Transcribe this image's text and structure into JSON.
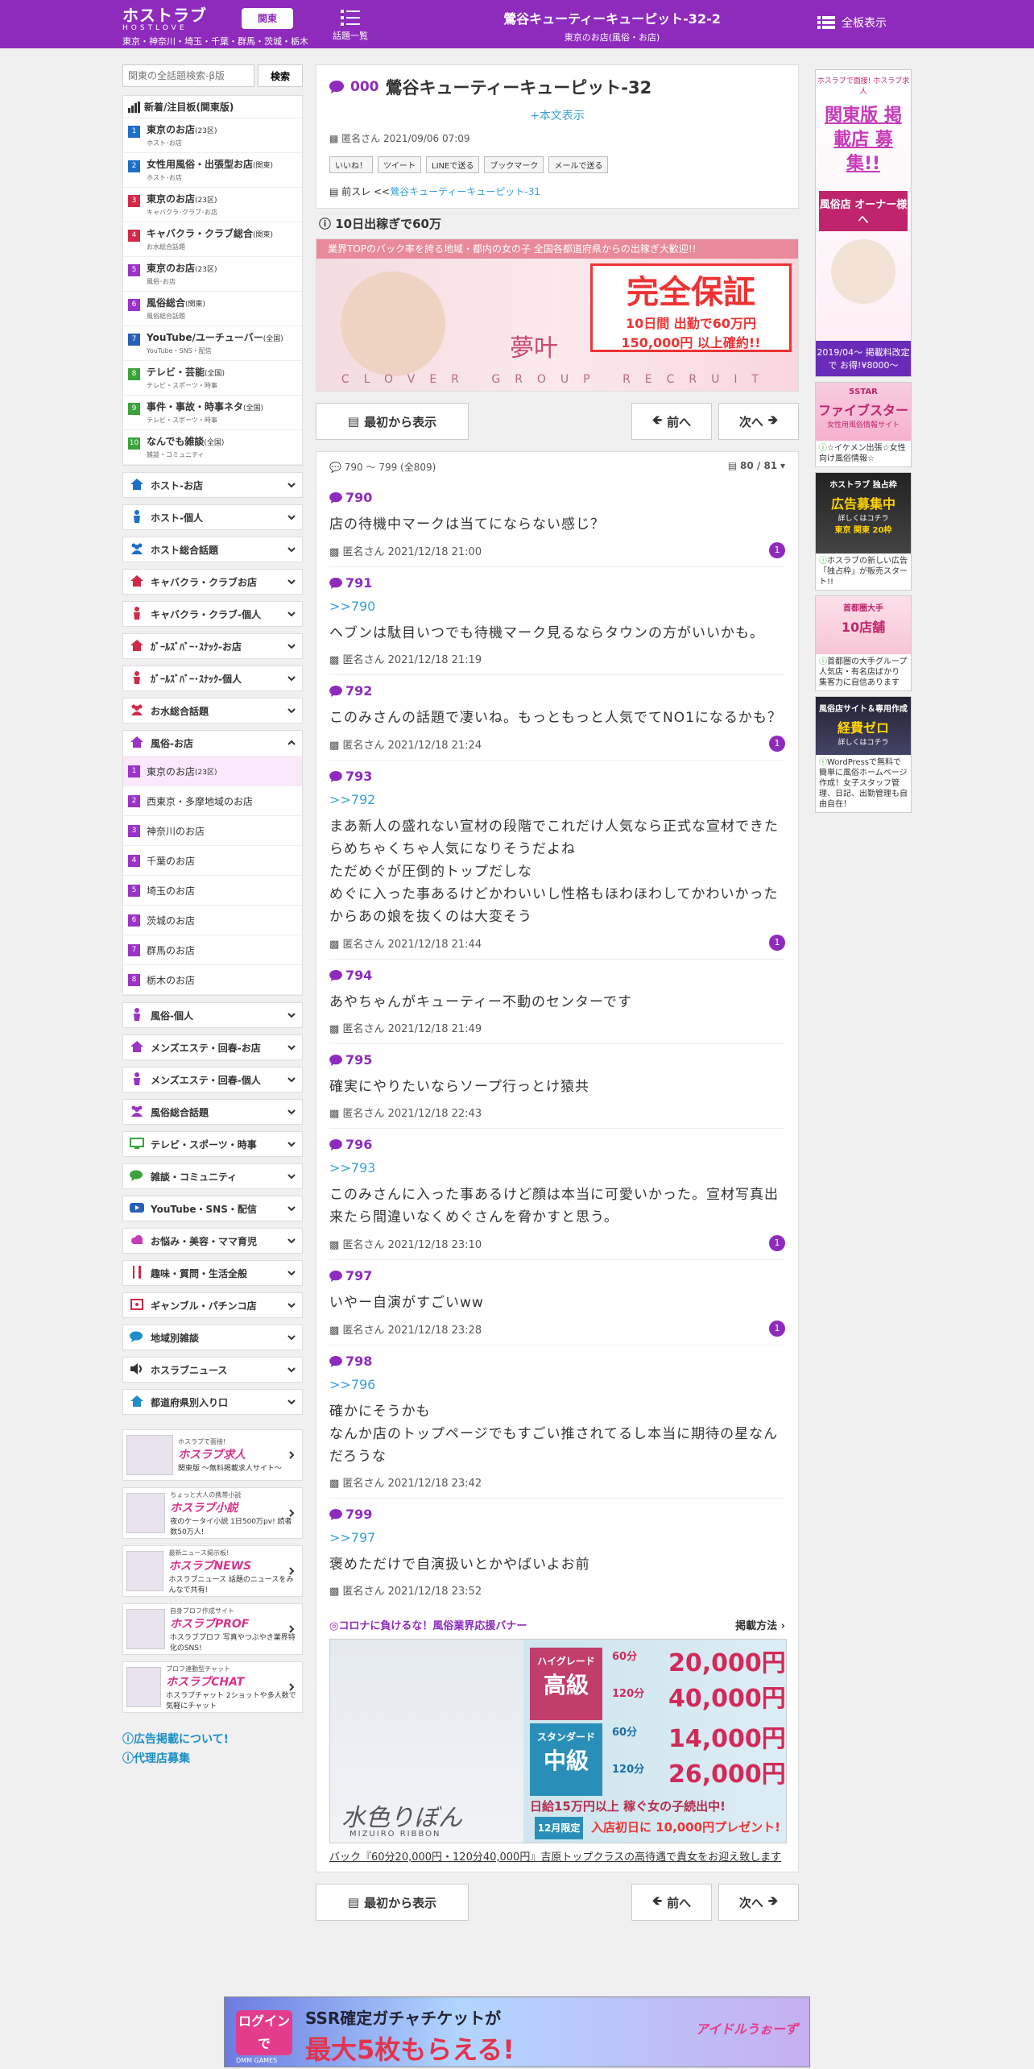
{
  "header": {
    "logo_main": "ホストラブ",
    "logo_sub": "HOSTLOVE",
    "region_button": "関東",
    "prefectures": "東京・神奈川・埼玉・千葉・群馬・茨城・栃木",
    "topics_label": "話題一覧",
    "thread_title": "鶯谷キューティーキューピット-32-2",
    "thread_category": "東京のお店(風俗・お店)",
    "full_display": "全板表示"
  },
  "sidebar": {
    "search_placeholder": "関東の全話題検索-β版",
    "search_button": "検索",
    "new_heading": "新着/注目板(関東版)",
    "boards": [
      {
        "num": "1",
        "color": "#1e6fc8",
        "name": "東京のお店",
        "suffix": "(23区)",
        "sub": "ホスト･お店"
      },
      {
        "num": "2",
        "color": "#1e6fc8",
        "name": "女性用風俗・出張型お店",
        "suffix": "(関東)",
        "sub": "ホスト･お店"
      },
      {
        "num": "3",
        "color": "#d12a4a",
        "name": "東京のお店",
        "suffix": "(23区)",
        "sub": "キャバクラ･クラブ･お店"
      },
      {
        "num": "4",
        "color": "#d12a4a",
        "name": "キャバクラ・クラブ総合",
        "suffix": "(関東)",
        "sub": "お水総合話題"
      },
      {
        "num": "5",
        "color": "#9b33c8",
        "name": "東京のお店",
        "suffix": "(23区)",
        "sub": "風俗･お店"
      },
      {
        "num": "6",
        "color": "#9b33c8",
        "name": "風俗総合",
        "suffix": "(関東)",
        "sub": "風俗総合話題"
      },
      {
        "num": "7",
        "color": "#2a5fb8",
        "name": "YouTube/ユーチューバー",
        "suffix": "(全国)",
        "sub": "YouTube・SNS・配信"
      },
      {
        "num": "8",
        "color": "#3aa43a",
        "name": "テレビ・芸能",
        "suffix": "(全国)",
        "sub": "テレビ・スポーツ・時事"
      },
      {
        "num": "9",
        "color": "#3aa43a",
        "name": "事件・事故・時事ネタ",
        "suffix": "(全国)",
        "sub": "テレビ・スポーツ・時事"
      },
      {
        "num": "10",
        "color": "#3aa43a",
        "name": "なんでも雑談",
        "suffix": "(全国)",
        "sub": "雑談・コミュニティ"
      }
    ],
    "categories_top": [
      {
        "label": "ホスト-お店",
        "icon": "house-icon",
        "color": "#1e6fc8"
      },
      {
        "label": "ホスト-個人",
        "icon": "person-icon",
        "color": "#1e6fc8"
      },
      {
        "label": "ホスト総合話題",
        "icon": "group-icon",
        "color": "#1e6fc8"
      },
      {
        "label": "キャバクラ・クラブお店",
        "icon": "house-icon",
        "color": "#d12a4a"
      },
      {
        "label": "キャバクラ・クラブ-個人",
        "icon": "person-icon",
        "color": "#d12a4a"
      },
      {
        "label": "ｶﾞｰﾙｽﾞﾊﾞｰ･ｽﾅｯｸ-お店",
        "icon": "house-icon",
        "color": "#d12a4a"
      },
      {
        "label": "ｶﾞｰﾙｽﾞﾊﾞｰ･ｽﾅｯｸ-個人",
        "icon": "person-icon",
        "color": "#d12a4a"
      },
      {
        "label": "お水総合話題",
        "icon": "group-icon",
        "color": "#d12a4a"
      }
    ],
    "fuzoku_header": "風俗-お店",
    "fuzoku_subs": [
      {
        "num": "1",
        "label": "東京のお店",
        "suffix": "(23区)"
      },
      {
        "num": "2",
        "label": "西東京・多摩地域のお店",
        "suffix": ""
      },
      {
        "num": "3",
        "label": "神奈川のお店",
        "suffix": ""
      },
      {
        "num": "4",
        "label": "千葉のお店",
        "suffix": ""
      },
      {
        "num": "5",
        "label": "埼玉のお店",
        "suffix": ""
      },
      {
        "num": "6",
        "label": "茨城のお店",
        "suffix": ""
      },
      {
        "num": "7",
        "label": "群馬のお店",
        "suffix": ""
      },
      {
        "num": "8",
        "label": "栃木のお店",
        "suffix": ""
      }
    ],
    "categories_bottom": [
      {
        "label": "風俗-個人",
        "icon": "person-icon",
        "color": "#9b33c8"
      },
      {
        "label": "メンズエステ・回春-お店",
        "icon": "house-icon",
        "color": "#9b33c8"
      },
      {
        "label": "メンズエステ・回春-個人",
        "icon": "person-icon",
        "color": "#9b33c8"
      },
      {
        "label": "風俗総合話題",
        "icon": "group-icon",
        "color": "#9b33c8"
      },
      {
        "label": "テレビ・スポーツ・時事",
        "icon": "tv-icon",
        "color": "#3aa43a"
      },
      {
        "label": "雑談・コミュニティ",
        "icon": "chat-icon",
        "color": "#3aa43a"
      },
      {
        "label": "YouTube・SNS・配信",
        "icon": "youtube-icon",
        "color": "#2a5fb8"
      },
      {
        "label": "お悩み・美容・ママ育児",
        "icon": "cloud-icon",
        "color": "#c83ab8"
      },
      {
        "label": "趣味・質問・生活全般",
        "icon": "fork-icon",
        "color": "#d12a4a"
      },
      {
        "label": "ギャンブル・パチンコ店",
        "icon": "dice-icon",
        "color": "#d12a4a"
      },
      {
        "label": "地域別雑談",
        "icon": "chat-icon",
        "color": "#1e8fc8"
      },
      {
        "label": "ホスラブニュース",
        "icon": "speaker-icon",
        "color": "#333333"
      },
      {
        "label": "都道府県別入り口",
        "icon": "house-icon",
        "color": "#1e8fc8"
      }
    ],
    "site_banners": [
      {
        "small": "ホスラブで面接!",
        "logo": "ホスラブ求人",
        "desc": "関東版 〜無料掲載求人サイト〜"
      },
      {
        "small": "ちょっと大人の携帯小説",
        "logo": "ホスラブ小説",
        "desc": "夜のケータイ小説 1日500万pv! 読者数50万人!"
      },
      {
        "small": "最新ニュース掲示板!",
        "logo": "ホスラブNEWS",
        "desc": "ホスラブニュース 話題のニュースをみんなで共有!"
      },
      {
        "small": "自身プロフ作成サイト",
        "logo": "ホスラブPROF",
        "desc": "ホスラブプロフ 写真やつぶやき業界特化のSNS!"
      },
      {
        "small": "プロフ連動型チャット",
        "logo": "ホスラブCHAT",
        "desc": "ホスラブチャット 2ショットや多人数で気軽にチャット"
      }
    ],
    "links": [
      "広告掲載について!",
      "代理店募集"
    ]
  },
  "main": {
    "first_post": {
      "no": "000",
      "title": "鶯谷キューティーキューピット-32",
      "show_body": "+本文表示",
      "author_date": "匿名さん 2021/09/06 07:09",
      "share_buttons": [
        "いいね！",
        "ツイート",
        "LINEで送る",
        "ブックマーク",
        "メールで送る"
      ],
      "prev_label": "前スレ <<",
      "prev_link": "鶯谷キューティーキューピット-31"
    },
    "promo": {
      "heading": "10日出稼ぎで60万",
      "ticker": "業界TOPのバック率を誇る地域・都内の女の子 全国各都道府県からの出稼ぎ大歓迎!!",
      "big": "完全保証",
      "amount1": "10日間 出勤で60万円",
      "amount2": "150,000円 以上確約!!",
      "footer": "CLOVER GROUP RECRUIT",
      "name": "夢叶"
    },
    "nav": {
      "first": "最初から表示",
      "prev": "前へ",
      "next": "次へ"
    },
    "list_range": "790 ～ 799 (全809)",
    "page_indicator": "80 / 81",
    "posts": [
      {
        "no": "790",
        "anchor": "",
        "body": "店の待機中マークは当てにならない感じ？",
        "meta": "匿名さん 2021/12/18 21:00",
        "badge": "1"
      },
      {
        "no": "791",
        "anchor": ">>790",
        "body": "ヘブンは駄目いつでも待機マーク見るならタウンの方がいいかも。",
        "meta": "匿名さん 2021/12/18 21:19",
        "badge": ""
      },
      {
        "no": "792",
        "anchor": "",
        "body": "このみさんの話題で凄いね。もっともっと人気でてNO1になるかも？",
        "meta": "匿名さん 2021/12/18 21:24",
        "badge": "1"
      },
      {
        "no": "793",
        "anchor": ">>792",
        "body": "まあ新人の盛れない宣材の段階でこれだけ人気なら正式な宣材できたらめちゃくちゃ人気になりそうだよね\nただめぐが圧倒的トップだしな\nめぐに入った事あるけどかわいいし性格もほわほわしてかわいかったからあの娘を抜くのは大変そう",
        "meta": "匿名さん 2021/12/18 21:44",
        "badge": "1"
      },
      {
        "no": "794",
        "anchor": "",
        "body": "あやちゃんがキューティー不動のセンターです",
        "meta": "匿名さん 2021/12/18 21:49",
        "badge": ""
      },
      {
        "no": "795",
        "anchor": "",
        "body": "確実にやりたいならソープ行っとけ猿共",
        "meta": "匿名さん 2021/12/18 22:43",
        "badge": ""
      },
      {
        "no": "796",
        "anchor": ">>793",
        "body": "このみさんに入った事あるけど顔は本当に可愛いかった。宣材写真出来たら間違いなくめぐさんを脅かすと思う。",
        "meta": "匿名さん 2021/12/18 23:10",
        "badge": "1"
      },
      {
        "no": "797",
        "anchor": "",
        "body": "いやー自演がすごいww",
        "meta": "匿名さん 2021/12/18 23:28",
        "badge": "1"
      },
      {
        "no": "798",
        "anchor": ">>796",
        "body": "確かにそうかも\nなんか店のトップページでもすごい推されてるし本当に期待の星なんだろうな",
        "meta": "匿名さん 2021/12/18 23:42",
        "badge": ""
      },
      {
        "no": "799",
        "anchor": ">>797",
        "body": "褒めただけで自演扱いとかやばいよお前",
        "meta": "匿名さん 2021/12/18 23:52",
        "badge": ""
      }
    ],
    "corona": {
      "title": "◎コロナに負けるな！風俗業界応援バナー",
      "method": "掲載方法",
      "grade1": "高級",
      "grade1_top": "ハイグレード",
      "grade2": "中級",
      "grade2_top": "スタンダード",
      "p1": "20,000円",
      "p2": "40,000円",
      "p3": "14,000円",
      "p4": "26,000円",
      "time60": "60分",
      "time120": "120分",
      "daily": "日給15万円以上 稼ぐ女の子続出中!",
      "limited": "12月限定",
      "first_day": "入店初日に 10,000円プレゼント!",
      "store": "水色りぼん",
      "store_en": "MIZUIRO RIBBON",
      "caption": "バック『60分20,000円・120分40,000円』吉原トップクラスの高待遇で貴女をお迎え致します"
    }
  },
  "right_ads": [
    {
      "top": "ホスラブで面接! ホスラブ求人",
      "big": "関東版 掲載店 募集!!",
      "mid": "風俗店 オーナー様へ",
      "bot": "2019/04〜 掲載料改定で お得!¥8000〜",
      "text": ""
    },
    {
      "top": "5STAR",
      "big": "ファイブスター",
      "mid": "女性用風俗情報サイト",
      "bot": "",
      "text": "☆イケメン出張☆女性向け風俗情報☆"
    },
    {
      "top": "ホストラブ 独占枠",
      "big": "広告募集中",
      "mid": "詳しくはコチラ",
      "bot": "東京 関東 20枠",
      "text": "ホスラブの新しい広告「独占枠」が販売スタート!!"
    },
    {
      "top": "首都圏大手",
      "big": "10店舗",
      "mid": "",
      "bot": "",
      "text": "首都圏の大手グループ 人気店・有名店ばかり 集客力に自信あります"
    },
    {
      "top": "風俗店サイト＆専用作成",
      "big": "経費ゼロ",
      "mid": "詳しくはコチラ",
      "bot": "",
      "text": "WordPressで無料で簡単に風俗ホームページ作成！女子スタッフ管理、日記、出勤管理も自由自在！"
    }
  ],
  "bottom_ad": {
    "left": "ログインで",
    "main": "SSR確定ガチャチケットが",
    "big": "最大5枚もらえる!",
    "brand": "DMM GAMES",
    "game": "アイドルうぉーず"
  },
  "colors": {
    "brand": "#8e2bbd",
    "link": "#3aa0d8"
  }
}
